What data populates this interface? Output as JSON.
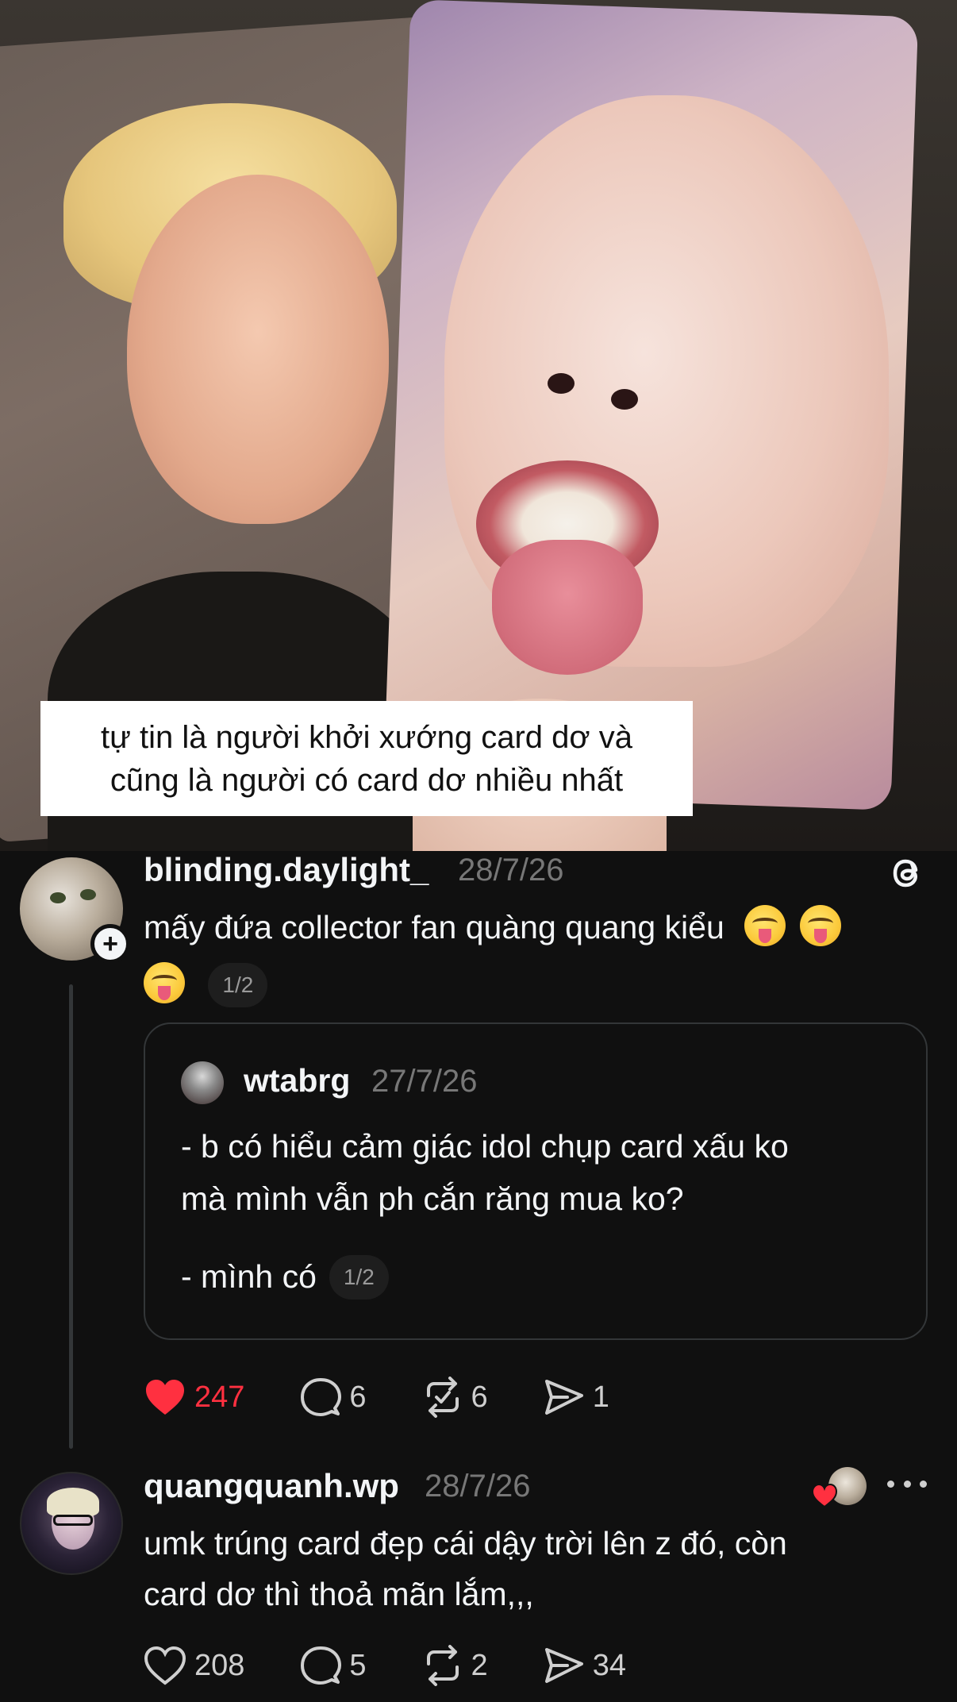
{
  "media": {
    "caption_line_1": "tự tin là người khởi xướng card dơ và",
    "caption_line_2": "cũng là người có card dơ nhiều nhất"
  },
  "post": {
    "username": "blinding.daylight_",
    "date": "28/7/26",
    "text": "mấy đứa collector fan quàng quang kiểu",
    "emoji_count": 3,
    "page_indicator": "1/2",
    "quote": {
      "username": "wtabrg",
      "date": "27/7/26",
      "line_1": "- b có hiểu cảm giác idol chụp card xấu ko",
      "line_2": "mà mình vẫn ph cắn răng mua ko?",
      "line_3": "- mình có",
      "page_indicator": "1/2"
    },
    "actions": {
      "likes": "247",
      "replies": "6",
      "reposts": "6",
      "shares": "1"
    }
  },
  "reply": {
    "username": "quangquanh.wp",
    "date": "28/7/26",
    "line_1": "umk trúng card đẹp cái dậy trời lên z đó, còn",
    "line_2": "card dơ thì thoả mãn lắm,,,",
    "actions": {
      "likes": "208",
      "replies": "5",
      "reposts": "2",
      "shares": "34"
    }
  },
  "colors": {
    "background": "#101010",
    "liked": "#ff3040",
    "muted": "#777777"
  },
  "icons": [
    "threads-logo-icon",
    "plus-icon",
    "heart-icon",
    "comment-icon",
    "repost-icon",
    "share-icon",
    "more-icon"
  ]
}
